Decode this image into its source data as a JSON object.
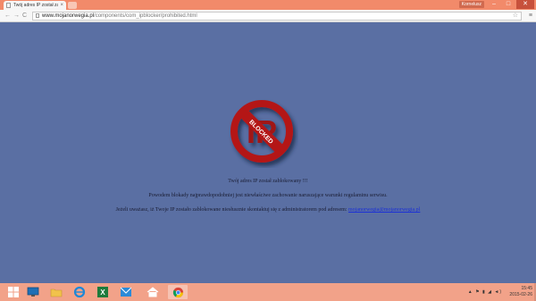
{
  "browser": {
    "tab_title": "Twój adres IP został zablok",
    "tab_close": "×",
    "user_label": "Kornelusz",
    "minimize": "–",
    "maximize": "□",
    "close": "✕"
  },
  "toolbar": {
    "back": "←",
    "forward": "→",
    "reload": "C",
    "url_domain": "www.mojanorwegia.pl",
    "url_path": "/components/com_ipblocker/prohibited.html",
    "star": "☆",
    "menu": "≡"
  },
  "page": {
    "logo_text": "BLOCKED",
    "line1": "Twój adres IP został zablokowany !!!",
    "line2": "Powodem blokady najprawdopodobniej jest niewłaściwe zachowanie naruszające warunki regulaminu serwisu.",
    "line3_prefix": "Jeżeli uważasz, iż Twoje IP zostało zablokowane niesłusznie skontaktuj się z administratorem pod adresem: ",
    "line3_email": "mojanorwegia@mojanorwegia.pl"
  },
  "taskbar": {
    "items": [
      "start-button",
      "desktop-icon",
      "file-explorer-icon",
      "internet-explorer-icon",
      "excel-icon",
      "outlook-icon",
      "home-icon",
      "chrome-icon"
    ],
    "time": "15:45",
    "date": "2015-02-26"
  },
  "colors": {
    "page_background": "#5a6fa3",
    "titlebar": "#f28a6a",
    "taskbar": "#f2a289",
    "logo_red": "#b41818",
    "link": "#1a2fd6"
  }
}
